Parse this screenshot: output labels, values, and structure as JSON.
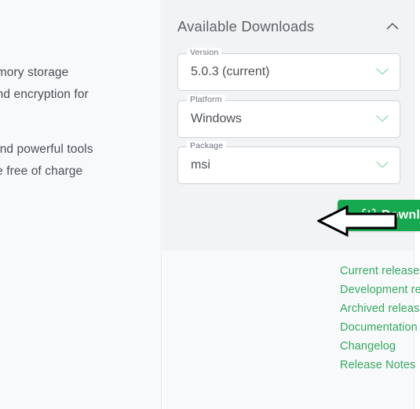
{
  "article": {
    "lines": [
      "n-memory storage",
      "ols, and encryption for",
      "ce and powerful tools",
      "ilable free of charge"
    ]
  },
  "panel": {
    "title": "Available Downloads",
    "collapse_icon": "chevron-up-icon",
    "fields": [
      {
        "label": "Version",
        "value": "5.0.3 (current)",
        "chevron_icon": "chevron-down-icon"
      },
      {
        "label": "Platform",
        "value": "Windows",
        "chevron_icon": "chevron-down-icon"
      },
      {
        "label": "Package",
        "value": "msi",
        "chevron_icon": "chevron-down-icon"
      }
    ],
    "download": {
      "label": "Download",
      "icon": "download-box-icon",
      "color": "#17a94f"
    },
    "annotation": {
      "icon": "left-arrow-annotation",
      "stroke": "#000000",
      "fill": "#ffffff"
    },
    "links": [
      "Current releases & packages",
      "Development releases",
      "Archived releases",
      "Documentation",
      "Changelog",
      "Release Notes"
    ],
    "link_color": "#35a95f"
  }
}
